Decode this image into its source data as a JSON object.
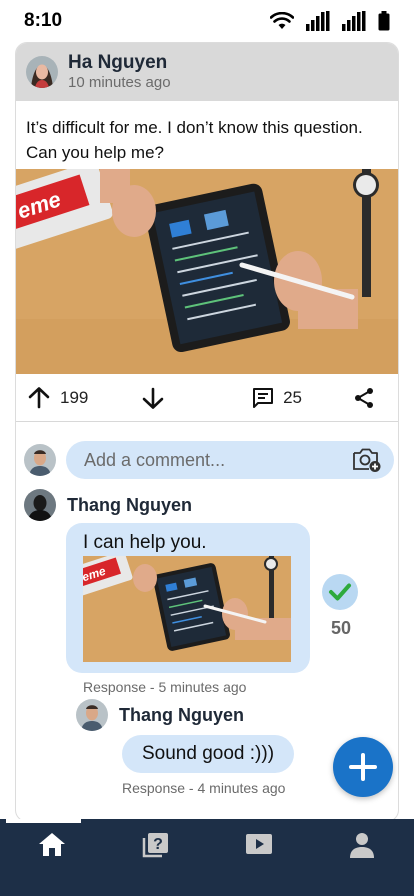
{
  "status_bar": {
    "time": "8:10"
  },
  "post": {
    "author": "Ha Nguyen",
    "time": "10 minutes ago",
    "text": "It’s difficult for me. I don’t know this question. Can you help me?",
    "image_text": "eme",
    "upvotes": "199",
    "comments": "25"
  },
  "comment_input": {
    "placeholder": "Add a comment..."
  },
  "comments": [
    {
      "author": "Thang Nguyen",
      "text": "I can help you.",
      "image_text": "eme",
      "accepted_count": "50",
      "meta": "Response - 5 minutes ago"
    },
    {
      "author": "Thang Nguyen",
      "text": "Sound good :)))",
      "meta": "Response - 4 minutes ago"
    }
  ],
  "icons": {
    "upvote": "arrow-up-icon",
    "downvote": "arrow-down-icon",
    "comment": "comment-icon",
    "share": "share-icon",
    "camera": "camera-add-icon",
    "accept": "check-icon",
    "fab": "plus-icon",
    "nav": [
      "home-icon",
      "question-icon",
      "video-icon",
      "profile-icon"
    ]
  },
  "colors": {
    "accent": "#1a73c8",
    "bubble": "#d4e6f9",
    "nav_bg": "#1d2f47",
    "check": "#2eaa3c"
  }
}
